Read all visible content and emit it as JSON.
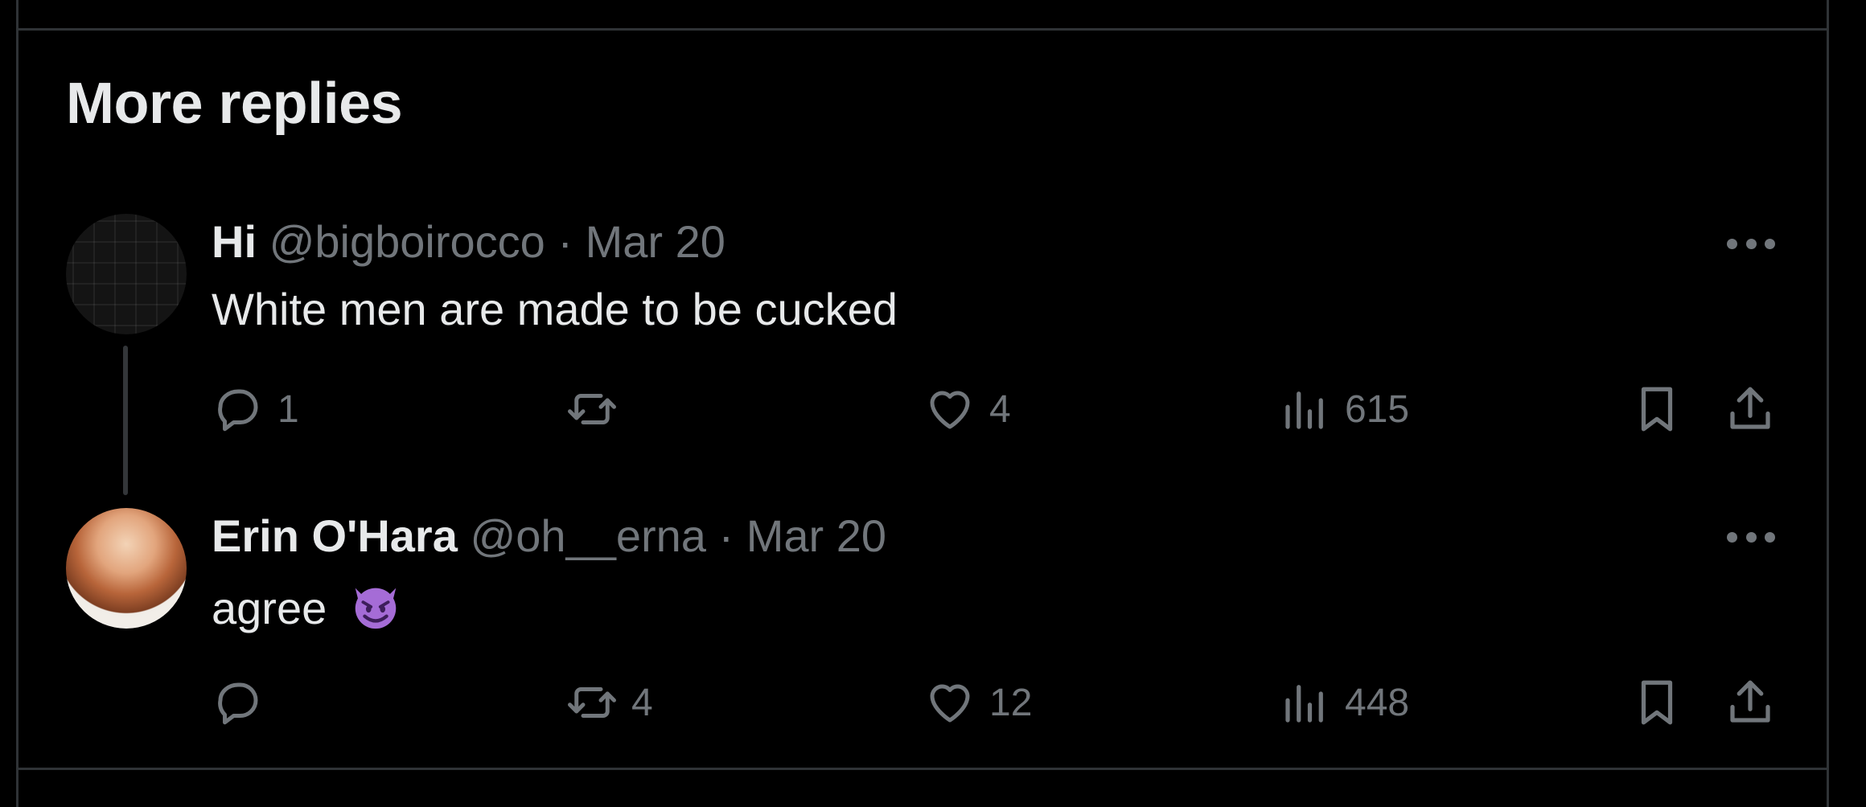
{
  "section": {
    "title": "More replies"
  },
  "tweets": [
    {
      "name": "Hi",
      "handle": "@bigboirocco",
      "date": "Mar 20",
      "text": "White men are made to be cucked",
      "emoji": "",
      "actions": {
        "reply": "1",
        "retweet": "",
        "like": "4",
        "views": "615"
      }
    },
    {
      "name": "Erin O'Hara",
      "handle": "@oh__erna",
      "date": "Mar 20",
      "text": "agree",
      "emoji": "smiling-face-with-horns",
      "actions": {
        "reply": "",
        "retweet": "4",
        "like": "12",
        "views": "448"
      }
    }
  ],
  "separator": "·",
  "icons": {
    "reply": "reply-icon",
    "retweet": "retweet-icon",
    "like": "heart-icon",
    "views": "views-icon",
    "bookmark": "bookmark-icon",
    "share": "share-icon",
    "more": "more-icon"
  },
  "colors": {
    "background": "#000000",
    "text": "#e7e9ea",
    "muted": "#71767b",
    "border": "#2f3336",
    "emoji": "#a56cd6"
  }
}
